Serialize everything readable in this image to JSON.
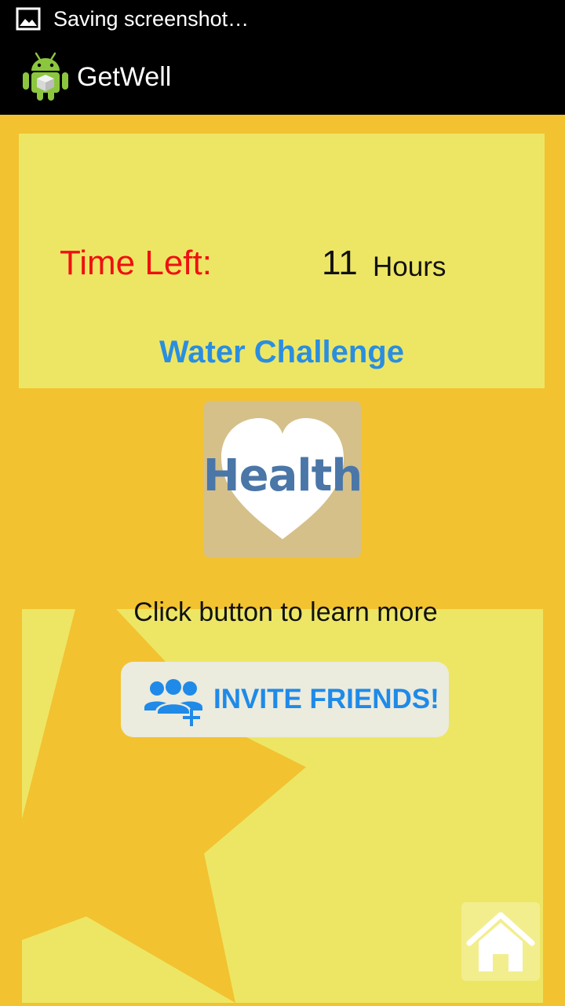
{
  "status_bar": {
    "notification_text": "Saving screenshot…",
    "notification_icon": "image-icon"
  },
  "action_bar": {
    "app_title": "GetWell",
    "app_icon": "android-icon"
  },
  "challenge_card": {
    "time_left_label": "Time Left:",
    "time_value": "11",
    "time_unit": "Hours",
    "challenge_name": "Water Challenge"
  },
  "health_image": {
    "text": "Health",
    "icon": "heart-icon"
  },
  "learn_more_text": "Click button to learn more",
  "invite_button": {
    "label": "INVITE FRIENDS!",
    "icon": "add-group-icon"
  },
  "home_button": {
    "icon": "home-icon"
  },
  "colors": {
    "background": "#f2c230",
    "card": "#ede664",
    "time_label": "#ee1111",
    "challenge_name": "#2a8ee0",
    "invite_label": "#1f8ae8",
    "health_tile": "#d5c08a",
    "health_text": "#4a76a8"
  }
}
